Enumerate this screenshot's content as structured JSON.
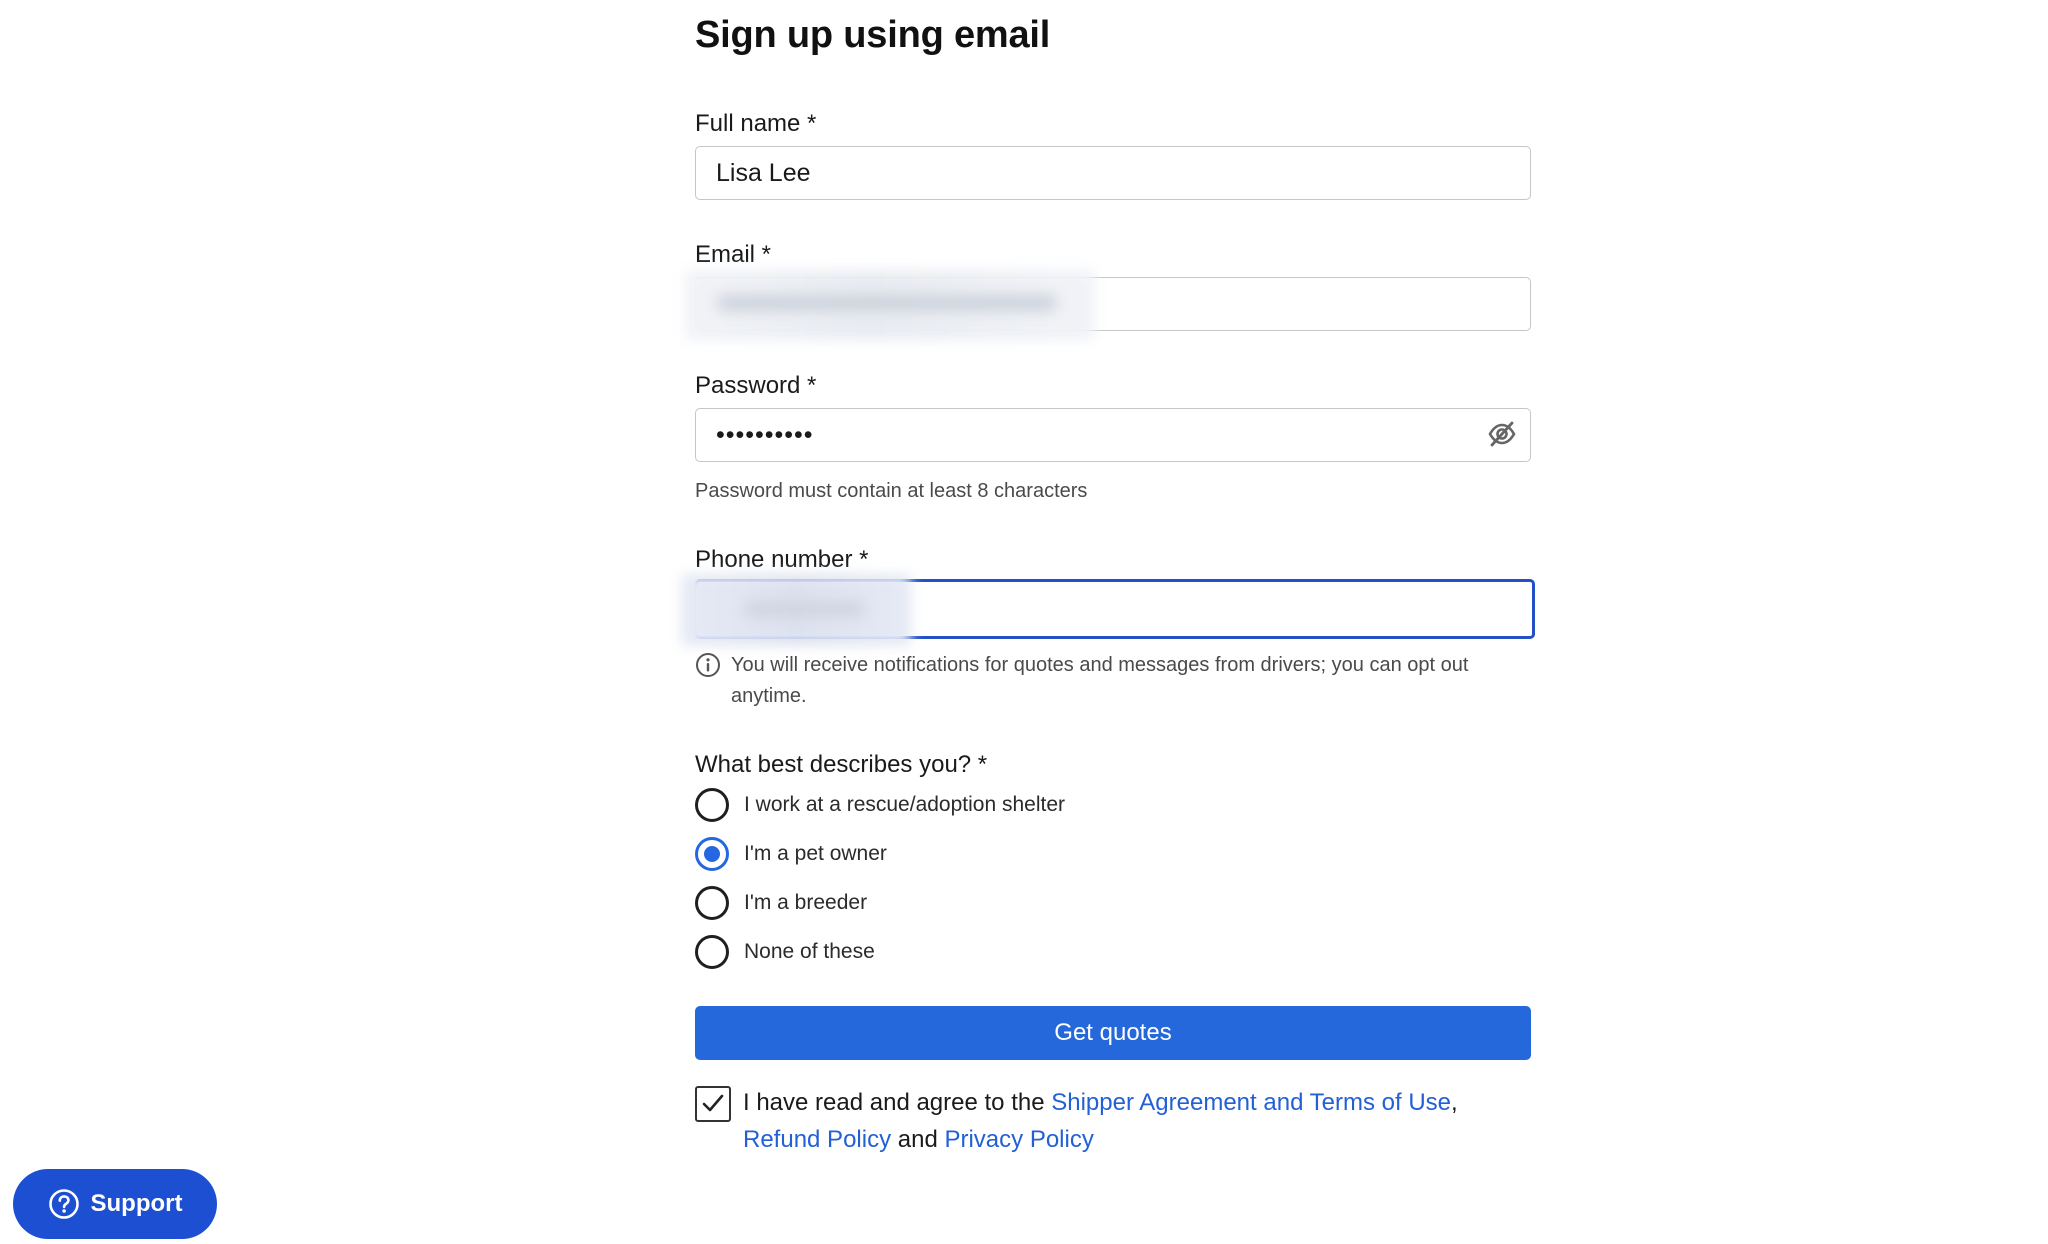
{
  "form": {
    "title": "Sign up using email",
    "full_name": {
      "label": "Full name *",
      "value": "Lisa Lee"
    },
    "email": {
      "label": "Email *",
      "value": ""
    },
    "password": {
      "label": "Password *",
      "value": "••••••••••",
      "hint": "Password must contain at least 8 characters"
    },
    "phone": {
      "label": "Phone number *",
      "value": "",
      "info": "You will receive notifications for quotes and messages from drivers; you can opt out anytime."
    },
    "describe": {
      "question": "What best describes you? *",
      "options": [
        {
          "label": "I work at a rescue/adoption shelter",
          "selected": false
        },
        {
          "label": "I'm a pet owner",
          "selected": true
        },
        {
          "label": "I'm a breeder",
          "selected": false
        },
        {
          "label": "None of these",
          "selected": false
        }
      ]
    },
    "submit_label": "Get quotes",
    "agreement": {
      "checked": true,
      "prefix": "I have read and agree to the ",
      "link_terms": "Shipper Agreement and Terms of Use",
      "comma": ",",
      "link_refund": "Refund Policy",
      "and": " and ",
      "link_privacy": "Privacy Policy"
    }
  },
  "support": {
    "label": "Support"
  },
  "colors": {
    "primary": "#2468dc",
    "focus_border": "#2450c7",
    "link": "#2360d6",
    "support_bg": "#1c4fd2"
  }
}
